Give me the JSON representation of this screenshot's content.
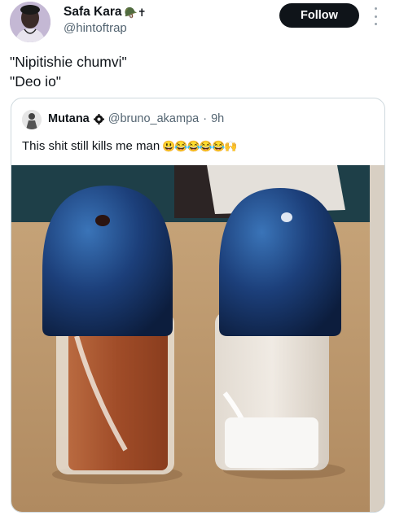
{
  "author": {
    "name": "Safa Kara",
    "badge_emoji": "🪖✝",
    "handle": "@hintoftrap"
  },
  "follow_label": "Follow",
  "tweet": {
    "line1": "\"Nipitishie chumvi\"",
    "line2": "\"Deo io\""
  },
  "quote": {
    "name": "Mutana",
    "handle": "@bruno_akampa",
    "separator": "·",
    "time": "9h",
    "text": "This shit still kills me man",
    "emojis": "😃😂😂😂😂🙌"
  },
  "icons": {
    "verified": "gear-badge-icon",
    "more": "more-dots-icon"
  },
  "colors": {
    "follow_bg": "#0f1419",
    "secondary_text": "#536471",
    "border": "#cfd9de"
  }
}
